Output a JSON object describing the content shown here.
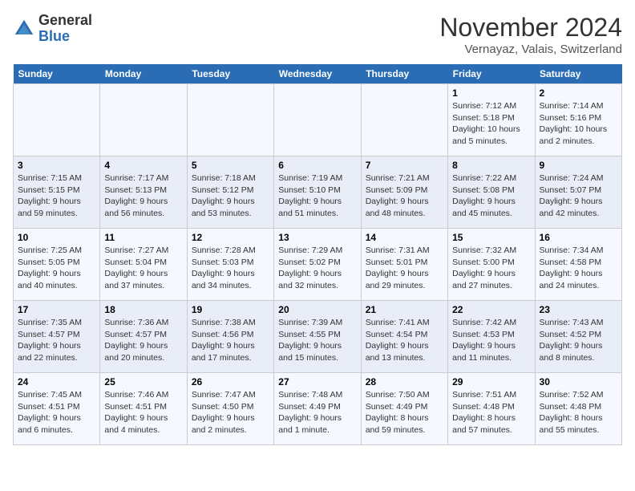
{
  "header": {
    "logo_general": "General",
    "logo_blue": "Blue",
    "month": "November 2024",
    "location": "Vernayaz, Valais, Switzerland"
  },
  "weekdays": [
    "Sunday",
    "Monday",
    "Tuesday",
    "Wednesday",
    "Thursday",
    "Friday",
    "Saturday"
  ],
  "weeks": [
    [
      {
        "day": "",
        "info": ""
      },
      {
        "day": "",
        "info": ""
      },
      {
        "day": "",
        "info": ""
      },
      {
        "day": "",
        "info": ""
      },
      {
        "day": "",
        "info": ""
      },
      {
        "day": "1",
        "info": "Sunrise: 7:12 AM\nSunset: 5:18 PM\nDaylight: 10 hours\nand 5 minutes."
      },
      {
        "day": "2",
        "info": "Sunrise: 7:14 AM\nSunset: 5:16 PM\nDaylight: 10 hours\nand 2 minutes."
      }
    ],
    [
      {
        "day": "3",
        "info": "Sunrise: 7:15 AM\nSunset: 5:15 PM\nDaylight: 9 hours\nand 59 minutes."
      },
      {
        "day": "4",
        "info": "Sunrise: 7:17 AM\nSunset: 5:13 PM\nDaylight: 9 hours\nand 56 minutes."
      },
      {
        "day": "5",
        "info": "Sunrise: 7:18 AM\nSunset: 5:12 PM\nDaylight: 9 hours\nand 53 minutes."
      },
      {
        "day": "6",
        "info": "Sunrise: 7:19 AM\nSunset: 5:10 PM\nDaylight: 9 hours\nand 51 minutes."
      },
      {
        "day": "7",
        "info": "Sunrise: 7:21 AM\nSunset: 5:09 PM\nDaylight: 9 hours\nand 48 minutes."
      },
      {
        "day": "8",
        "info": "Sunrise: 7:22 AM\nSunset: 5:08 PM\nDaylight: 9 hours\nand 45 minutes."
      },
      {
        "day": "9",
        "info": "Sunrise: 7:24 AM\nSunset: 5:07 PM\nDaylight: 9 hours\nand 42 minutes."
      }
    ],
    [
      {
        "day": "10",
        "info": "Sunrise: 7:25 AM\nSunset: 5:05 PM\nDaylight: 9 hours\nand 40 minutes."
      },
      {
        "day": "11",
        "info": "Sunrise: 7:27 AM\nSunset: 5:04 PM\nDaylight: 9 hours\nand 37 minutes."
      },
      {
        "day": "12",
        "info": "Sunrise: 7:28 AM\nSunset: 5:03 PM\nDaylight: 9 hours\nand 34 minutes."
      },
      {
        "day": "13",
        "info": "Sunrise: 7:29 AM\nSunset: 5:02 PM\nDaylight: 9 hours\nand 32 minutes."
      },
      {
        "day": "14",
        "info": "Sunrise: 7:31 AM\nSunset: 5:01 PM\nDaylight: 9 hours\nand 29 minutes."
      },
      {
        "day": "15",
        "info": "Sunrise: 7:32 AM\nSunset: 5:00 PM\nDaylight: 9 hours\nand 27 minutes."
      },
      {
        "day": "16",
        "info": "Sunrise: 7:34 AM\nSunset: 4:58 PM\nDaylight: 9 hours\nand 24 minutes."
      }
    ],
    [
      {
        "day": "17",
        "info": "Sunrise: 7:35 AM\nSunset: 4:57 PM\nDaylight: 9 hours\nand 22 minutes."
      },
      {
        "day": "18",
        "info": "Sunrise: 7:36 AM\nSunset: 4:57 PM\nDaylight: 9 hours\nand 20 minutes."
      },
      {
        "day": "19",
        "info": "Sunrise: 7:38 AM\nSunset: 4:56 PM\nDaylight: 9 hours\nand 17 minutes."
      },
      {
        "day": "20",
        "info": "Sunrise: 7:39 AM\nSunset: 4:55 PM\nDaylight: 9 hours\nand 15 minutes."
      },
      {
        "day": "21",
        "info": "Sunrise: 7:41 AM\nSunset: 4:54 PM\nDaylight: 9 hours\nand 13 minutes."
      },
      {
        "day": "22",
        "info": "Sunrise: 7:42 AM\nSunset: 4:53 PM\nDaylight: 9 hours\nand 11 minutes."
      },
      {
        "day": "23",
        "info": "Sunrise: 7:43 AM\nSunset: 4:52 PM\nDaylight: 9 hours\nand 8 minutes."
      }
    ],
    [
      {
        "day": "24",
        "info": "Sunrise: 7:45 AM\nSunset: 4:51 PM\nDaylight: 9 hours\nand 6 minutes."
      },
      {
        "day": "25",
        "info": "Sunrise: 7:46 AM\nSunset: 4:51 PM\nDaylight: 9 hours\nand 4 minutes."
      },
      {
        "day": "26",
        "info": "Sunrise: 7:47 AM\nSunset: 4:50 PM\nDaylight: 9 hours\nand 2 minutes."
      },
      {
        "day": "27",
        "info": "Sunrise: 7:48 AM\nSunset: 4:49 PM\nDaylight: 9 hours\nand 1 minute."
      },
      {
        "day": "28",
        "info": "Sunrise: 7:50 AM\nSunset: 4:49 PM\nDaylight: 8 hours\nand 59 minutes."
      },
      {
        "day": "29",
        "info": "Sunrise: 7:51 AM\nSunset: 4:48 PM\nDaylight: 8 hours\nand 57 minutes."
      },
      {
        "day": "30",
        "info": "Sunrise: 7:52 AM\nSunset: 4:48 PM\nDaylight: 8 hours\nand 55 minutes."
      }
    ]
  ]
}
